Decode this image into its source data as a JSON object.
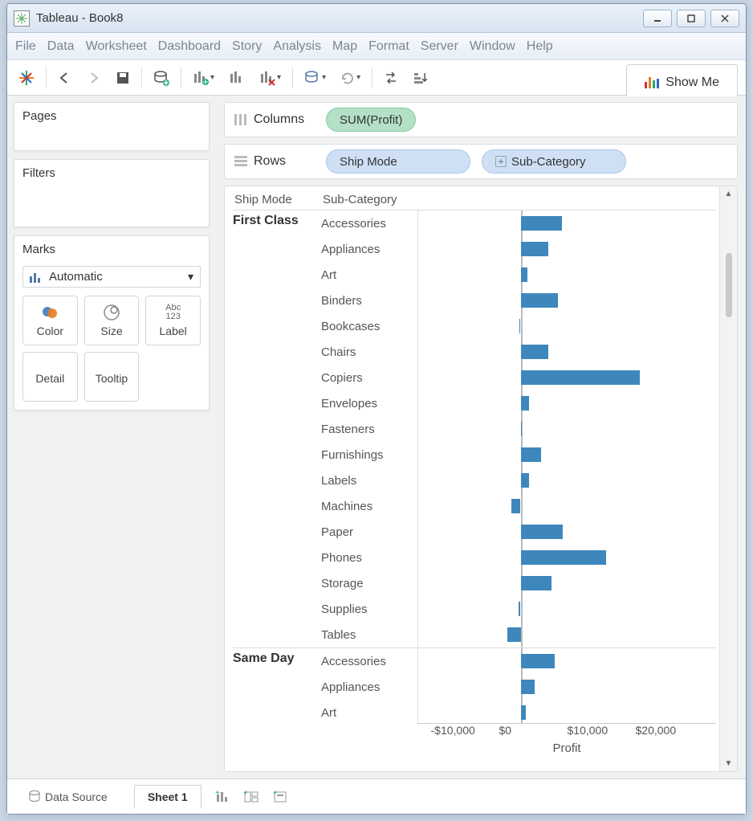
{
  "app": {
    "title": "Tableau - Book8"
  },
  "menu": [
    "File",
    "Data",
    "Worksheet",
    "Dashboard",
    "Story",
    "Analysis",
    "Map",
    "Format",
    "Server",
    "Window",
    "Help"
  ],
  "toolbar": {
    "show_me": "Show Me"
  },
  "side": {
    "pages_label": "Pages",
    "filters_label": "Filters",
    "marks_label": "Marks",
    "marktype": "Automatic",
    "cells": {
      "color": "Color",
      "size": "Size",
      "label": "Label",
      "detail": "Detail",
      "tooltip": "Tooltip"
    }
  },
  "shelves": {
    "columns_label": "Columns",
    "rows_label": "Rows",
    "columns_pill": "SUM(Profit)",
    "rows_pill_1": "Ship Mode",
    "rows_pill_2": "Sub-Category"
  },
  "viz": {
    "header_ship": "Ship Mode",
    "header_sub": "Sub-Category",
    "axis_title": "Profit",
    "ticks": [
      "-$10,000",
      "$0",
      "$10,000",
      "$20,000"
    ]
  },
  "chart_data": {
    "type": "bar",
    "xlabel": "Profit",
    "xlim": [
      -15000,
      25000
    ],
    "tick_values": [
      -10000,
      0,
      10000,
      20000
    ],
    "groups": [
      {
        "name": "First Class",
        "items": [
          {
            "label": "Accessories",
            "value": 6000
          },
          {
            "label": "Appliances",
            "value": 4000
          },
          {
            "label": "Art",
            "value": 1000
          },
          {
            "label": "Binders",
            "value": 5500
          },
          {
            "label": "Bookcases",
            "value": -200
          },
          {
            "label": "Chairs",
            "value": 4000
          },
          {
            "label": "Copiers",
            "value": 17500
          },
          {
            "label": "Envelopes",
            "value": 1200
          },
          {
            "label": "Fasteners",
            "value": 200
          },
          {
            "label": "Furnishings",
            "value": 3000
          },
          {
            "label": "Labels",
            "value": 1200
          },
          {
            "label": "Machines",
            "value": -1400
          },
          {
            "label": "Paper",
            "value": 6200
          },
          {
            "label": "Phones",
            "value": 12500
          },
          {
            "label": "Storage",
            "value": 4500
          },
          {
            "label": "Supplies",
            "value": -300
          },
          {
            "label": "Tables",
            "value": -2000
          }
        ]
      },
      {
        "name": "Same Day",
        "items": [
          {
            "label": "Accessories",
            "value": 5000
          },
          {
            "label": "Appliances",
            "value": 2000
          },
          {
            "label": "Art",
            "value": 800
          }
        ]
      }
    ]
  },
  "tabs": {
    "data_source": "Data Source",
    "sheet": "Sheet 1"
  }
}
